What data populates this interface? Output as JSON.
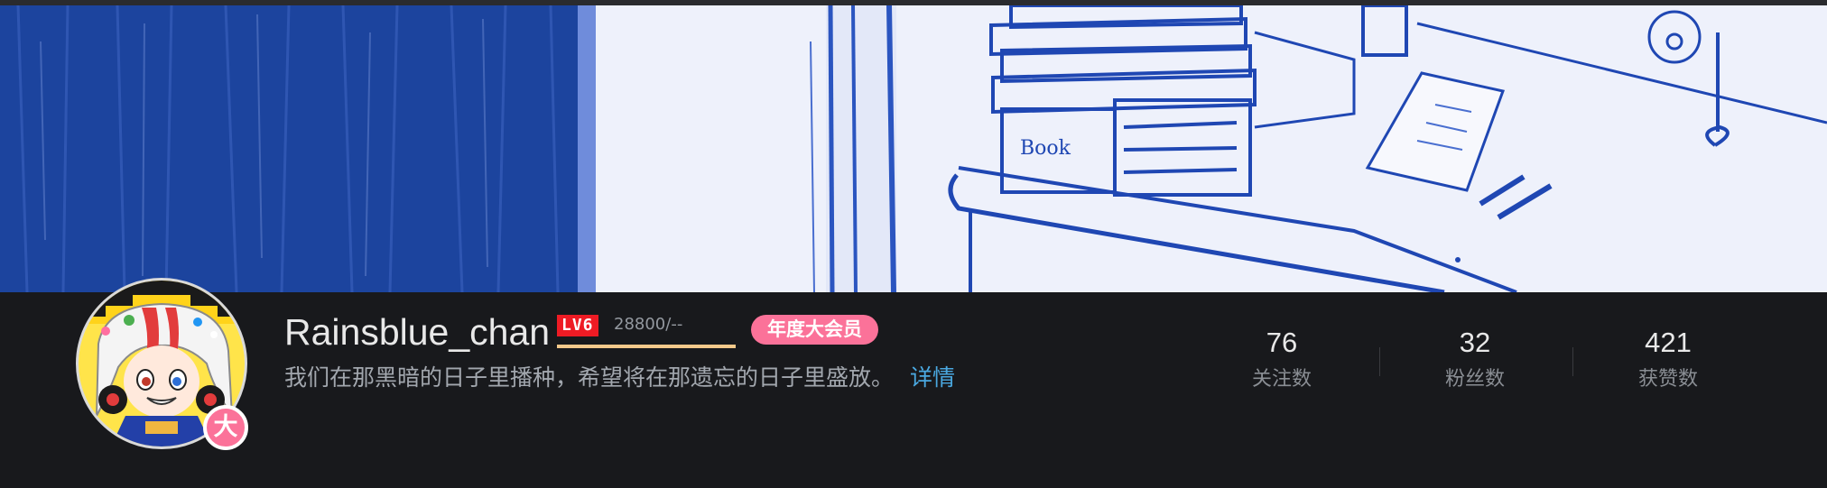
{
  "profile": {
    "username": "Rainsblue_chan",
    "level_label": "LV6",
    "experience_text": "28800/--",
    "experience_progress": 1.0,
    "member_tag": "年度大会员",
    "vip_badge_char": "大",
    "bio": "我们在那黑暗的日子里播种，希望将在那遗忘的日子里盛放。",
    "bio_detail_link": "详情"
  },
  "stats": {
    "following": {
      "value": "76",
      "label": "关注数"
    },
    "followers": {
      "value": "32",
      "label": "粉丝数"
    },
    "likes": {
      "value": "421",
      "label": "获赞数"
    }
  },
  "colors": {
    "background": "#18191c",
    "accent_pink": "#fb7299",
    "level_red": "#ee1b24",
    "link_blue": "#4aa8e0",
    "exp_gold": "#f3c98b"
  },
  "icons": {
    "avatar": "anime-avatar-image",
    "banner": "blue-pencil-sketch-banner"
  }
}
